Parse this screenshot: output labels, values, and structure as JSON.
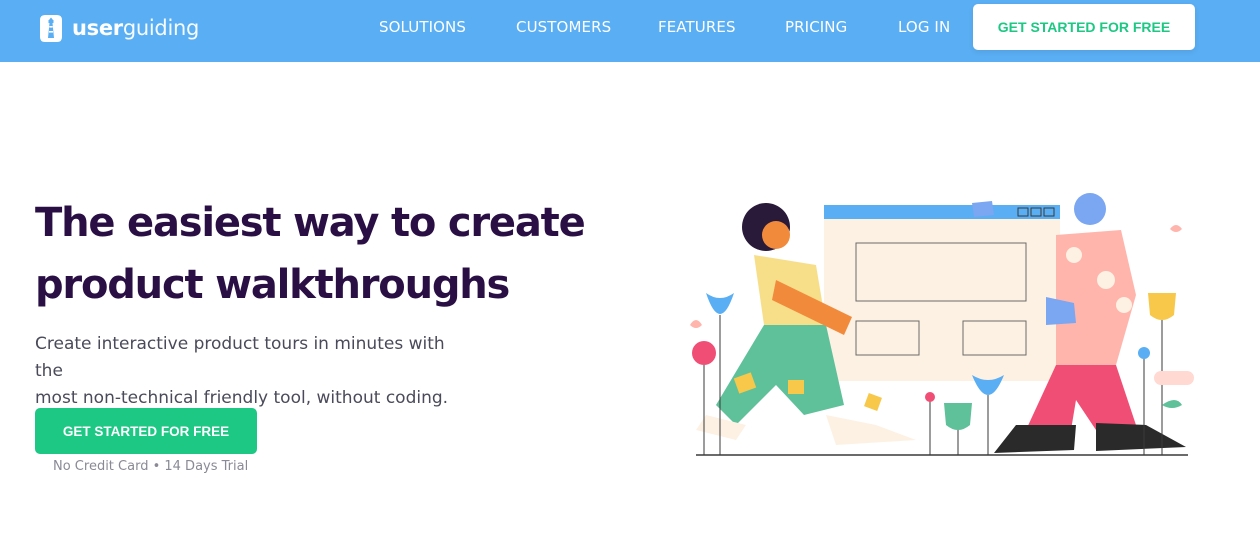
{
  "brand": {
    "name_bold": "user",
    "name_light": "guiding"
  },
  "nav": {
    "items": [
      {
        "label": "SOLUTIONS"
      },
      {
        "label": "CUSTOMERS"
      },
      {
        "label": "FEATURES"
      },
      {
        "label": "PRICING"
      },
      {
        "label": "LOG IN"
      }
    ],
    "cta_label": "GET STARTED FOR FREE"
  },
  "hero": {
    "title_line1": "The easiest way to create",
    "title_line2": "product walkthroughs",
    "subtitle_line1": "Create interactive product tours in minutes with the",
    "subtitle_line2": "most non-technical friendly tool, without coding.",
    "cta_label": "GET STARTED FOR FREE",
    "note": "No Credit Card • 14 Days Trial"
  },
  "colors": {
    "nav_bg": "#5aaef3",
    "accent_green": "#1cc883",
    "title_color": "#2a0f45"
  },
  "icons": {
    "logo": "lighthouse-icon"
  }
}
